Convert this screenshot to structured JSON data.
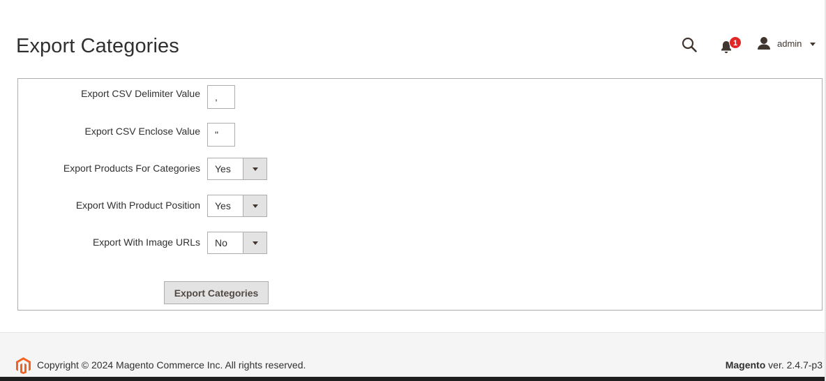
{
  "header": {
    "title": "Export Categories",
    "search_icon": "search-icon",
    "notifications": {
      "icon": "bell-icon",
      "count": "1"
    },
    "user": {
      "icon": "user-icon",
      "name": "admin"
    }
  },
  "form": {
    "fields": [
      {
        "label": "Export CSV Delimiter Value",
        "type": "text",
        "value": ","
      },
      {
        "label": "Export CSV Enclose Value",
        "type": "text",
        "value": "\""
      },
      {
        "label": "Export Products For Categories",
        "type": "select",
        "value": "Yes"
      },
      {
        "label": "Export With Product Position",
        "type": "select",
        "value": "Yes"
      },
      {
        "label": "Export With Image URLs",
        "type": "select",
        "value": "No"
      }
    ],
    "submit_label": "Export Categories"
  },
  "footer": {
    "logo": "magento-logo-icon",
    "copyright": "Copyright © 2024 Magento Commerce Inc. All rights reserved.",
    "brand": "Magento",
    "version": " ver. 2.4.7-p3"
  },
  "colors": {
    "badge": "#e22626",
    "logo": "#f26322",
    "footer_bg": "#f5f5f5"
  }
}
